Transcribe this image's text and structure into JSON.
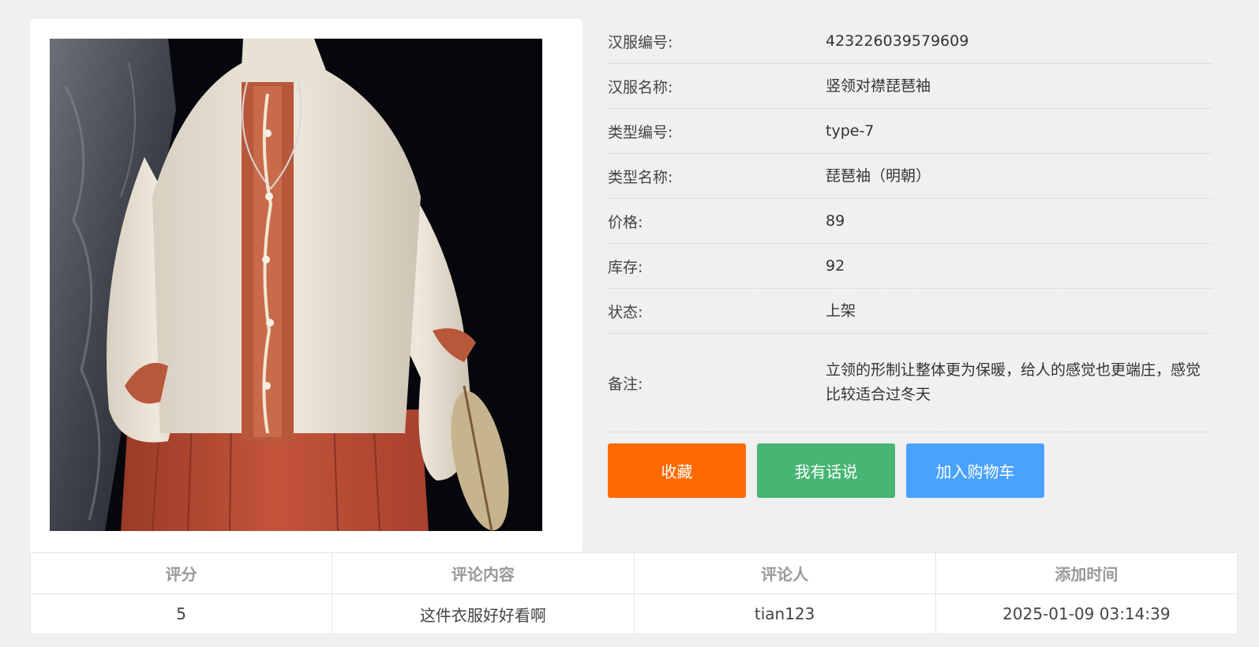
{
  "product": {
    "image_alt": "汉服图片",
    "fields": [
      {
        "label": "汉服编号:",
        "value": "423226039579609"
      },
      {
        "label": "汉服名称:",
        "value": "竖领对襟琵琶袖"
      },
      {
        "label": "类型编号:",
        "value": "type-7"
      },
      {
        "label": "类型名称:",
        "value": "琵琶袖（明朝）"
      },
      {
        "label": "价格:",
        "value": "89"
      },
      {
        "label": "库存:",
        "value": "92"
      },
      {
        "label": "状态:",
        "value": "上架"
      },
      {
        "label": "备注:",
        "value": "立领的形制让整体更为保暖，给人的感觉也更端庄，感觉比较适合过冬天"
      }
    ]
  },
  "actions": {
    "favorite": "收藏",
    "comment": "我有话说",
    "cart": "加入购物车"
  },
  "reviews": {
    "headers": [
      "评分",
      "评论内容",
      "评论人",
      "添加时间"
    ],
    "rows": [
      [
        "5",
        "这件衣服好好看啊",
        "tian123",
        "2025-01-09 03:14:39"
      ]
    ]
  },
  "colors": {
    "favorite": "#ff6a00",
    "comment": "#48b574",
    "cart": "#4aa2ff"
  }
}
